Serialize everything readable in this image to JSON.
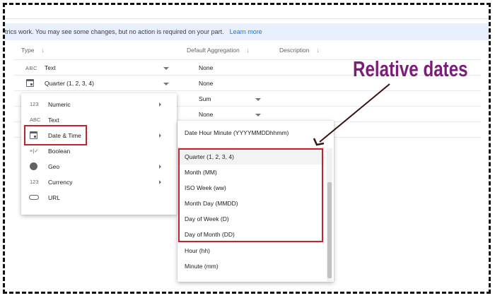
{
  "banner": {
    "text": "trics work. You may see some changes, but no action is required on your part.",
    "link": "Learn more"
  },
  "columns": {
    "type": "Type",
    "default_aggregation": "Default Aggregation",
    "description": "Description",
    "sort_arrow": "↓"
  },
  "rows": [
    {
      "type_icon": "ABC",
      "type_label": "Text",
      "aggregation": "None"
    },
    {
      "type_icon": "calendar-icon",
      "type_label": "Quarter (1, 2, 3, 4)",
      "aggregation": "None"
    },
    {
      "aggregation": "Sum"
    },
    {
      "aggregation": "None"
    }
  ],
  "type_menu": {
    "items": [
      {
        "icon": "123",
        "label": "Numeric",
        "has_submenu": true
      },
      {
        "icon": "ABC",
        "label": "Text",
        "has_submenu": false
      },
      {
        "icon": "calendar-icon",
        "label": "Date & Time",
        "has_submenu": true,
        "selected": true
      },
      {
        "icon": "×|✓",
        "label": "Boolean",
        "has_submenu": false
      },
      {
        "icon": "globe-icon",
        "label": "Geo",
        "has_submenu": true
      },
      {
        "icon": "123",
        "label": "Currency",
        "has_submenu": true
      },
      {
        "icon": "link-icon",
        "label": "URL",
        "has_submenu": false
      }
    ]
  },
  "date_submenu": {
    "items": [
      "Date Hour Minute (YYYYMMDDhhmm)",
      "Quarter (1, 2, 3, 4)",
      "Month (MM)",
      "ISO Week (ww)",
      "Month Day (MMDD)",
      "Day of Week (D)",
      "Day of Month (DD)",
      "Hour (hh)",
      "Minute (mm)"
    ]
  },
  "annotation": {
    "label": "Relative dates",
    "label_color": "#7b1e7a",
    "box_color": "#c5222b"
  }
}
